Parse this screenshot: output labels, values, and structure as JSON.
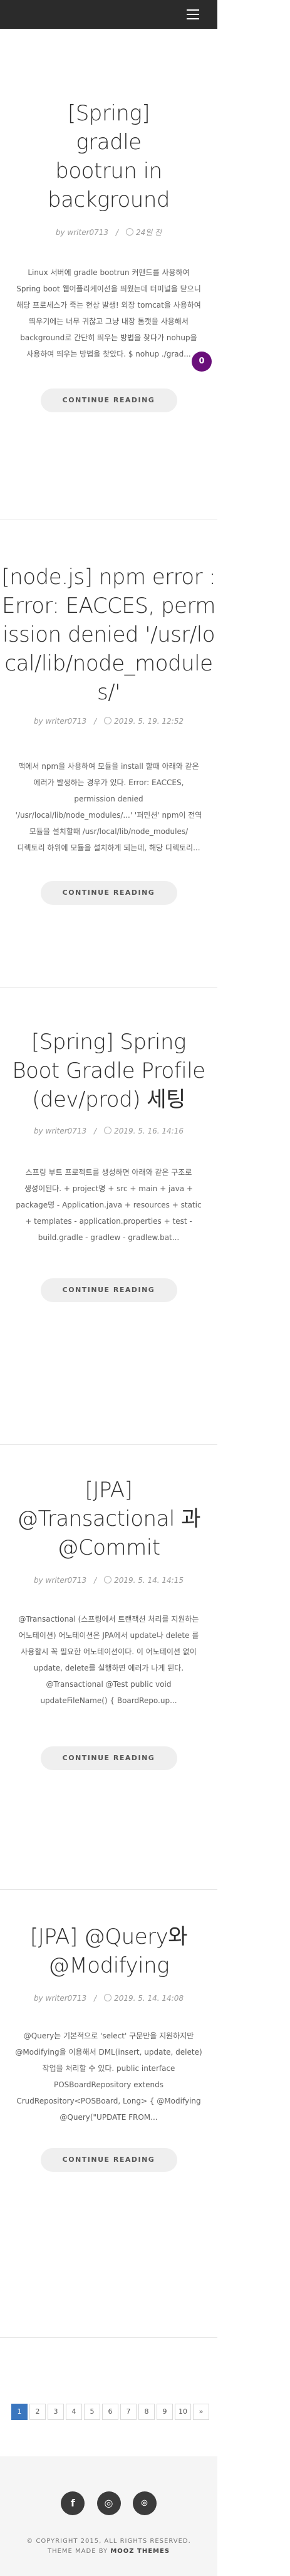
{
  "posts": [
    {
      "title": "[Spring] gradle bootrun in background",
      "author": "by writer0713",
      "date": "24일 전",
      "excerpt": "Linux 서버에 gradle bootrun 커맨드를 사용하여 Spring boot 웹어플리케이션을 띄웠는데 터미널을 닫으니 해당 프로세스가 죽는 현상 발생! 외장 tomcat을 사용하여 띄우기에는 너무 귀찮고 그냥 내장 톰캣을 사용해서 background로 간단히 띄우는 방법을 찾다가 nohup을 사용하여 띄우는 방법을 찾았다. $ nohup ./grad...",
      "button": "CONTINUE READING"
    },
    {
      "title": "[node.js] npm error : Error: EACCES, permission denied '/usr/local/lib/node_modules/'",
      "author": "by writer0713",
      "date": "2019. 5. 19. 12:52",
      "excerpt": "맥에서 npm을 사용하여 모듈을 install 할때 아래와 같은 에러가 발생하는 경우가 있다. Error: EACCES, permission denied '/usr/local/lib/node_modules/...' '퍼민션' npm이 전역 모듈을 설치할때 /usr/local/lib/node_modules/ 디렉토리 하위에 모듈을 설치하게 되는데, 해당 디렉토리...",
      "button": "CONTINUE READING"
    },
    {
      "title": "[Spring] Spring Boot Gradle Profile (dev/prod) 세팅",
      "author": "by writer0713",
      "date": "2019. 5. 16. 14:16",
      "excerpt": "스프링 부트 프로젝트를 생성하면 아래와 같은 구조로 생성이된다. + project명 + src + main + java + package명 - Application.java + resources + static + templates - application.properties + test - build.gradle - gradlew - gradlew.bat...",
      "button": "CONTINUE READING"
    },
    {
      "title": "[JPA] @Transactional 과 @Commit",
      "author": "by writer0713",
      "date": "2019. 5. 14. 14:15",
      "excerpt": "@Transactional (스프링에서 트랜잭션 처리를 지원하는 어노테이션) 어노테이션은 JPA에서 update나 delete 를 사용할시 꼭 필요한 어노테이션이다. 이 어노테이션 없이 update, delete를 실행하면 에러가 나게 된다. @Transactional @Test public void updateFileName() { BoardRepo.up...",
      "button": "CONTINUE READING"
    },
    {
      "title": "[JPA] @Query와 @Modifying",
      "author": "by writer0713",
      "date": "2019. 5. 14. 14:08",
      "excerpt": "@Query는 기본적으로 'select' 구문만을 지원하지만 @Modifying을 이용해서 DML(insert, update, delete) 작업을 처리할 수 있다. public interface POSBoardRepository extends CrudRepository<POSBoard, Long> { @Modifying @Query(\"UPDATE FROM...",
      "button": "CONTINUE READING"
    }
  ],
  "badge": "0",
  "pagination": [
    "1",
    "2",
    "3",
    "4",
    "5",
    "6",
    "7",
    "8",
    "9",
    "10",
    "»"
  ],
  "pagination_active": 0,
  "footer": {
    "social_icons": [
      "facebook-icon",
      "instagram-icon",
      "github-icon"
    ],
    "social_glyphs": [
      "f",
      "◎",
      "⌾"
    ],
    "copyright": "© COPYRIGHT 2015, ALL RIGHTS RESERVED.",
    "theme_prefix": "THEME MADE BY",
    "theme_name": "MOOZ THEMES"
  },
  "colors": {
    "topbar": "#2b2b2b",
    "accent": "#3a76bf",
    "badge": "#6a0f7a"
  }
}
